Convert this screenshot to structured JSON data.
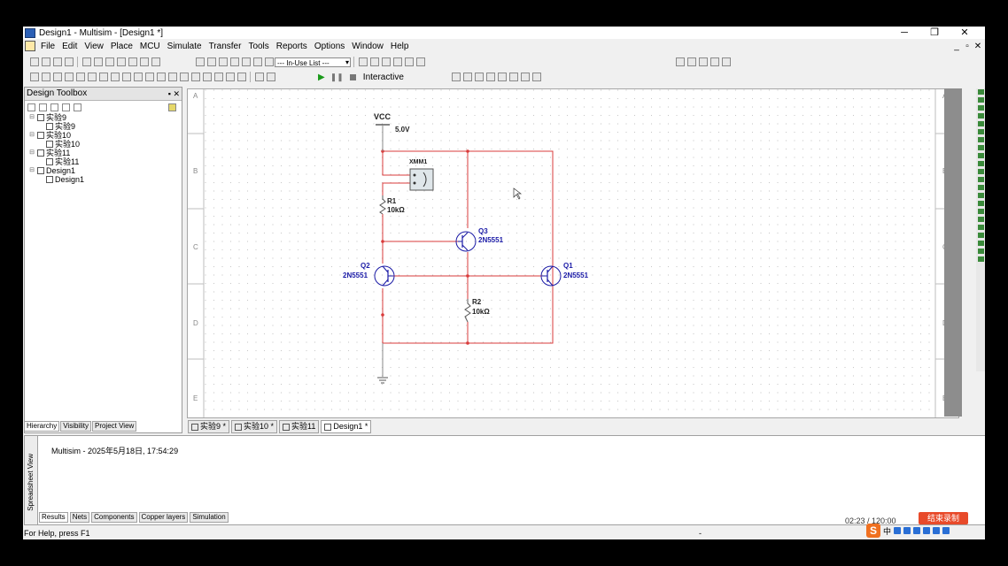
{
  "window": {
    "title": "Design1 - Multisim - [Design1 *]",
    "controls": [
      "─",
      "❐",
      "✕"
    ]
  },
  "menu": [
    "File",
    "Edit",
    "View",
    "Place",
    "MCU",
    "Simulate",
    "Transfer",
    "Tools",
    "Reports",
    "Options",
    "Window",
    "Help"
  ],
  "mdi_controls": [
    "_",
    "▫",
    "✕"
  ],
  "toolbar": {
    "in_use_list": "--- In-Use List ---",
    "interactive_label": "Interactive"
  },
  "design_toolbox": {
    "title": "Design Toolbox",
    "tree": [
      {
        "label": "实验9",
        "child": "实验9"
      },
      {
        "label": "实验10",
        "child": "实验10"
      },
      {
        "label": "实验11",
        "child": "实验11"
      },
      {
        "label": "Design1",
        "child": "Design1"
      }
    ],
    "tabs": [
      "Hierarchy",
      "Visibility",
      "Project View"
    ]
  },
  "schematic": {
    "row_labels": [
      "A",
      "B",
      "C",
      "D",
      "E"
    ],
    "vcc": {
      "name": "VCC",
      "value": "5.0V"
    },
    "xmm": {
      "name": "XMM1"
    },
    "r1": {
      "name": "R1",
      "value": "10kΩ"
    },
    "r2": {
      "name": "R2",
      "value": "10kΩ"
    },
    "q1": {
      "name": "Q1",
      "model": "2N5551"
    },
    "q2": {
      "name": "Q2",
      "model": "2N5551"
    },
    "q3": {
      "name": "Q3",
      "model": "2N5551"
    },
    "colors": {
      "wire": "#d93b3b",
      "part_label": "#1a1aa6",
      "grid_dot": "#c8c8c8"
    }
  },
  "doc_tabs": [
    "实验9 *",
    "实验10 *",
    "实验11",
    "Design1 *"
  ],
  "spreadsheet": {
    "vertical_label": "Spreadsheet View",
    "message": "Multisim  -  2025年5月18日, 17:54:29",
    "tabs": [
      "Results",
      "Nets",
      "Components",
      "Copper layers",
      "Simulation"
    ]
  },
  "status_bar": {
    "text": "For Help, press F1",
    "dash": "-"
  },
  "overlay": {
    "time": "02:23 / 120:00",
    "end_record": "结束录制",
    "ime_char": "中"
  }
}
